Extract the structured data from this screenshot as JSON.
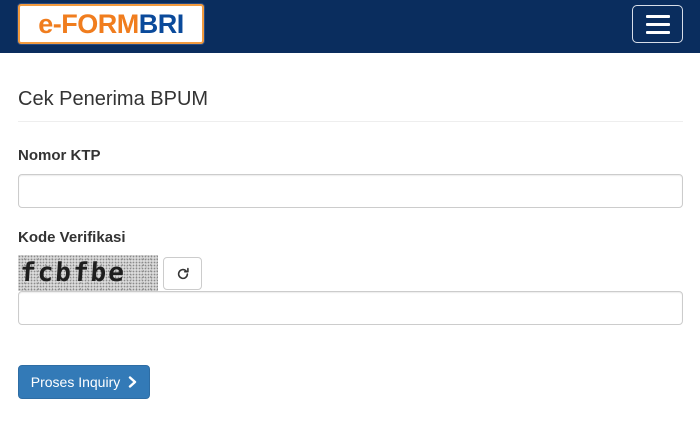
{
  "header": {
    "logo_part1": "e-FORM",
    "logo_part2": "BRI",
    "menu_icon": "hamburger-menu-icon"
  },
  "form": {
    "title": "Cek Penerima BPUM",
    "ktp_label": "Nomor KTP",
    "ktp_value": "",
    "verification_label": "Kode Verifikasi",
    "captcha_text": "fcbfbe",
    "refresh_icon": "refresh-icon",
    "verification_value": "",
    "submit_label": "Proses Inquiry",
    "submit_icon": "chevron-right-icon"
  },
  "colors": {
    "navbar": "#0a2d5e",
    "button": "#337ab7",
    "logo_orange": "#f07d1e",
    "logo_blue": "#0a4a9b"
  }
}
